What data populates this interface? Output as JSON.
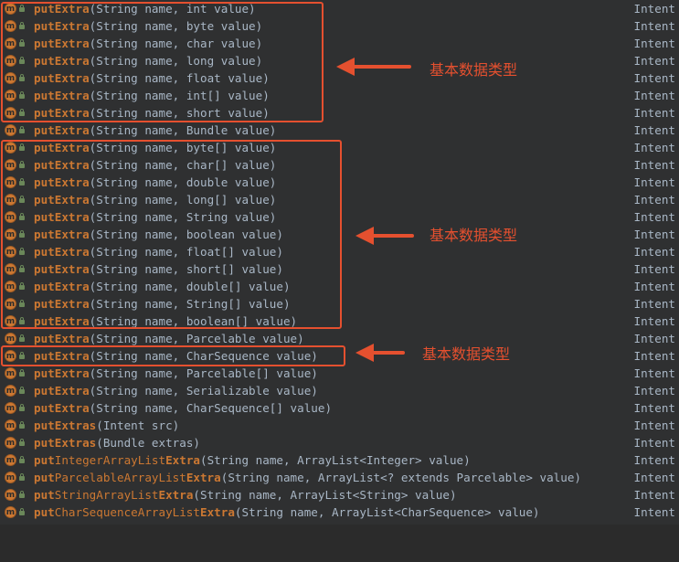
{
  "completion": {
    "return_type": "Intent",
    "items": [
      {
        "name": "putExtra",
        "params": "(String name, int value)"
      },
      {
        "name": "putExtra",
        "params": "(String name, byte value)"
      },
      {
        "name": "putExtra",
        "params": "(String name, char value)"
      },
      {
        "name": "putExtra",
        "params": "(String name, long value)"
      },
      {
        "name": "putExtra",
        "params": "(String name, float value)"
      },
      {
        "name": "putExtra",
        "params": "(String name, int[] value)"
      },
      {
        "name": "putExtra",
        "params": "(String name, short value)"
      },
      {
        "name": "putExtra",
        "params": "(String name, Bundle value)"
      },
      {
        "name": "putExtra",
        "params": "(String name, byte[] value)"
      },
      {
        "name": "putExtra",
        "params": "(String name, char[] value)"
      },
      {
        "name": "putExtra",
        "params": "(String name, double value)"
      },
      {
        "name": "putExtra",
        "params": "(String name, long[] value)"
      },
      {
        "name": "putExtra",
        "params": "(String name, String value)"
      },
      {
        "name": "putExtra",
        "params": "(String name, boolean value)"
      },
      {
        "name": "putExtra",
        "params": "(String name, float[] value)"
      },
      {
        "name": "putExtra",
        "params": "(String name, short[] value)"
      },
      {
        "name": "putExtra",
        "params": "(String name, double[] value)"
      },
      {
        "name": "putExtra",
        "params": "(String name, String[] value)"
      },
      {
        "name": "putExtra",
        "params": "(String name, boolean[] value)"
      },
      {
        "name": "putExtra",
        "params": "(String name, Parcelable value)"
      },
      {
        "name": "putExtra",
        "params": "(String name, CharSequence value)"
      },
      {
        "name": "putExtra",
        "params": "(String name, Parcelable[] value)"
      },
      {
        "name": "putExtra",
        "params": "(String name, Serializable value)"
      },
      {
        "name": "putExtra",
        "params": "(String name, CharSequence[] value)"
      },
      {
        "name": "putExtras",
        "params": "(Intent src)"
      },
      {
        "name": "putExtras",
        "params": "(Bundle extras)"
      },
      {
        "name": "putIntegerArrayListExtra",
        "params": "(String name, ArrayList<Integer> value)"
      },
      {
        "name": "putParcelableArrayListExtra",
        "params": "(String name, ArrayList<? extends Parcelable> value)"
      },
      {
        "name": "putStringArrayListExtra",
        "params": "(String name, ArrayList<String> value)"
      },
      {
        "name": "putCharSequenceArrayListExtra",
        "params": "(String name, ArrayList<CharSequence> value)"
      }
    ]
  },
  "annotations": [
    {
      "label": "基本数据类型"
    },
    {
      "label": "基本数据类型"
    },
    {
      "label": "基本数据类型"
    }
  ],
  "colors": {
    "highlight": "#e5502f",
    "method_name": "#cc7832",
    "text": "#a9b7c6",
    "background": "#2f3031"
  },
  "icons": {
    "method": "method-icon",
    "visibility": "public-lock-icon"
  }
}
